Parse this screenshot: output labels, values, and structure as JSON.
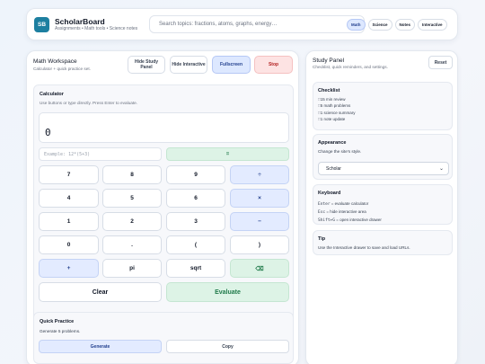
{
  "header": {
    "logo": "SB",
    "title": "ScholarBoard",
    "subtitle": "Assignments • Math tools • Science notes",
    "search_placeholder": "Search topics: fractions, atoms, graphs, energy…",
    "pills": [
      "Math",
      "Science",
      "Notes",
      "Interactive"
    ],
    "active_pill": "Math"
  },
  "workspace": {
    "title": "Math Workspace",
    "subtitle": "Calculator + quick practice set.",
    "buttons": {
      "hide_study": "Hide Study Panel",
      "hide_interactive": "Hide Interactive",
      "fullscreen": "Fullscreen",
      "stop": "Stop"
    }
  },
  "calculator": {
    "title": "Calculator",
    "subtitle": "Use buttons or type directly. Press Enter to evaluate.",
    "display_value": "0",
    "expression_placeholder": "Example: 12*(5+3)",
    "equals_label": "=",
    "keys": [
      [
        "7",
        "8",
        "9",
        "÷"
      ],
      [
        "4",
        "5",
        "6",
        "×"
      ],
      [
        "1",
        "2",
        "3",
        "−"
      ],
      [
        "0",
        ".",
        "(",
        ")"
      ],
      [
        "+",
        "pi",
        "sqrt",
        "⌫"
      ]
    ],
    "clear_label": "Clear",
    "evaluate_label": "Evaluate"
  },
  "practice": {
    "title": "Quick Practice",
    "subtitle": "Generate 5 problems.",
    "generate_label": "Generate",
    "copy_label": "Copy"
  },
  "study_panel": {
    "title": "Study Panel",
    "subtitle": "Checklist, quick reminders, and settings.",
    "reset_label": "Reset",
    "checklist": {
      "title": "Checklist",
      "items": [
        "15 min review",
        "5 math problems",
        "1 science summary",
        "1 note update"
      ]
    },
    "appearance": {
      "title": "Appearance",
      "subtitle": "Change the site's style.",
      "selected_theme": "Scholar"
    },
    "keyboard": {
      "title": "Keyboard",
      "lines": [
        {
          "key": "Enter",
          "desc": " = evaluate calculator"
        },
        {
          "key": "Esc",
          "desc": " = hide interactive area"
        },
        {
          "key": "Shift+G",
          "desc": " = open interactive drawer"
        }
      ]
    },
    "tip": {
      "title": "Tip",
      "text": "Use the Interactive drawer to save and load URLs."
    }
  },
  "colors": {
    "accent": "#23408e",
    "accent_bg": "#dde8ff",
    "success": "#1f7a4a",
    "success_bg": "#ddf3e6",
    "danger": "#b42323",
    "danger_bg": "#fde3e3",
    "logo_bg": "#1d7fa0"
  }
}
